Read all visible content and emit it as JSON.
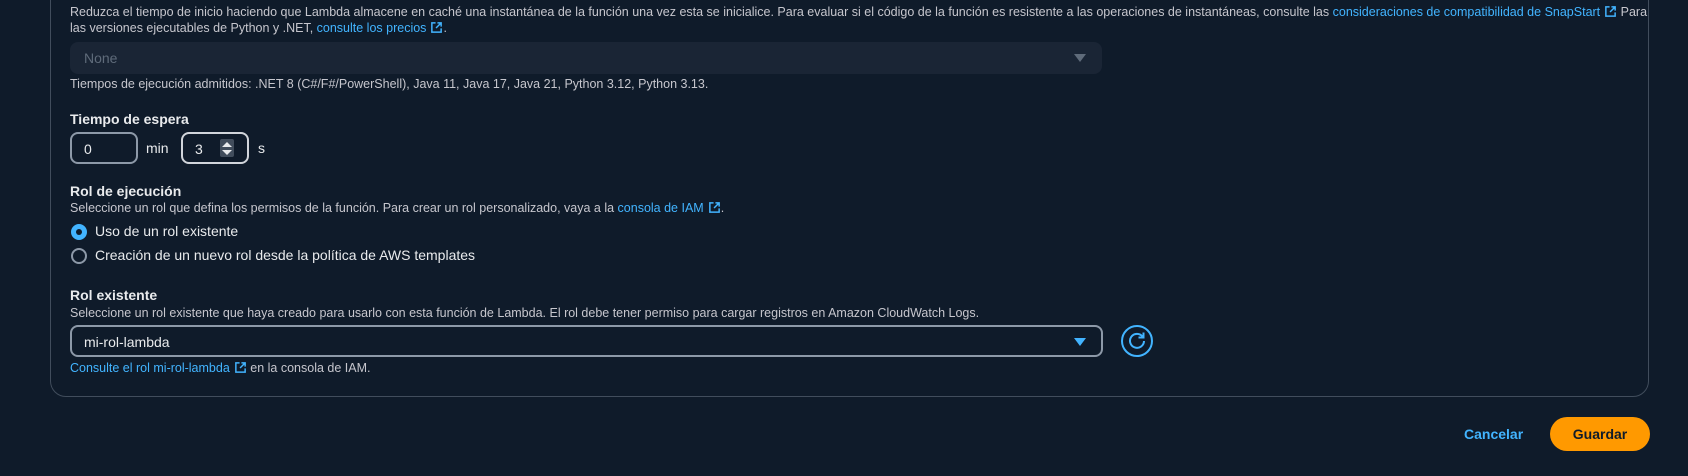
{
  "snapstart": {
    "desc_prefix": "Reduzca el tiempo de inicio haciendo que Lambda almacene en caché una instantánea de la función una vez esta se inicialice. Para evaluar si el código de la función es resistente a las operaciones de instantáneas, consulte las ",
    "compat_link": "consideraciones de compatibilidad de SnapStart",
    "desc_mid": " Para",
    "desc_line2_prefix": "las versiones ejecutables de Python y .NET, ",
    "pricing_link": "consulte los precios",
    "desc_line2_suffix": ".",
    "select_value": "None",
    "supported_runtimes": "Tiempos de ejecución admitidos: .NET 8 (C#/F#/PowerShell), Java 11, Java 17, Java 21, Python 3.12, Python 3.13."
  },
  "timeout": {
    "label": "Tiempo de espera",
    "minutes_value": "0",
    "minutes_unit": "min",
    "seconds_value": "3",
    "seconds_unit": "s"
  },
  "execution_role": {
    "label": "Rol de ejecución",
    "desc_prefix": "Seleccione un rol que defina los permisos de la función. Para crear un rol personalizado, vaya a la ",
    "iam_link": "consola de IAM",
    "desc_suffix": ".",
    "options": [
      {
        "label": "Uso de un rol existente",
        "checked": true
      },
      {
        "label": "Creación de un nuevo rol desde la política de AWS templates",
        "checked": false
      }
    ]
  },
  "existing_role": {
    "label": "Rol existente",
    "desc": "Seleccione un rol existente que haya creado para usarlo con esta función de Lambda. El rol debe tener permiso para cargar registros en Amazon CloudWatch Logs.",
    "selected": "mi-rol-lambda",
    "view_link": "Consulte el rol mi-rol-lambda",
    "view_suffix": " en la consola de IAM."
  },
  "footer": {
    "cancel_label": "Cancelar",
    "save_label": "Guardar"
  },
  "colors": {
    "background": "#0f1b2a",
    "link": "#42b4ff",
    "primary": "#ff9900"
  }
}
